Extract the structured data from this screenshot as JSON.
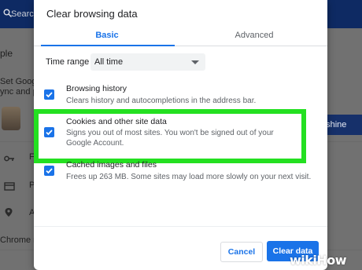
{
  "background": {
    "search_label": "Search",
    "fragments": [
      "ple",
      "Set Google",
      "ync and p",
      "nshine",
      "Chrome na"
    ],
    "row_letters": [
      "F",
      "P",
      "A"
    ]
  },
  "dialog": {
    "title": "Clear browsing data",
    "tabs": [
      {
        "label": "Basic",
        "selected": true
      },
      {
        "label": "Advanced",
        "selected": false
      }
    ],
    "time_range": {
      "label": "Time range",
      "value": "All time"
    },
    "options": [
      {
        "title": "Browsing history",
        "description": "Clears history and autocompletions in the address bar.",
        "checked": true
      },
      {
        "title": "Cookies and other site data",
        "description": "Signs you out of most sites. You won't be signed out of your Google Account.",
        "checked": true
      },
      {
        "title": "Cached images and files",
        "description": "Frees up 263 MB. Some sites may load more slowly on your next visit.",
        "checked": true
      }
    ],
    "buttons": {
      "cancel": "Cancel",
      "confirm": "Clear data"
    }
  },
  "watermark": "wikiHow",
  "colors": {
    "accent": "#1a73e8",
    "highlight": "#24e021",
    "topbar": "#0e2a63"
  }
}
